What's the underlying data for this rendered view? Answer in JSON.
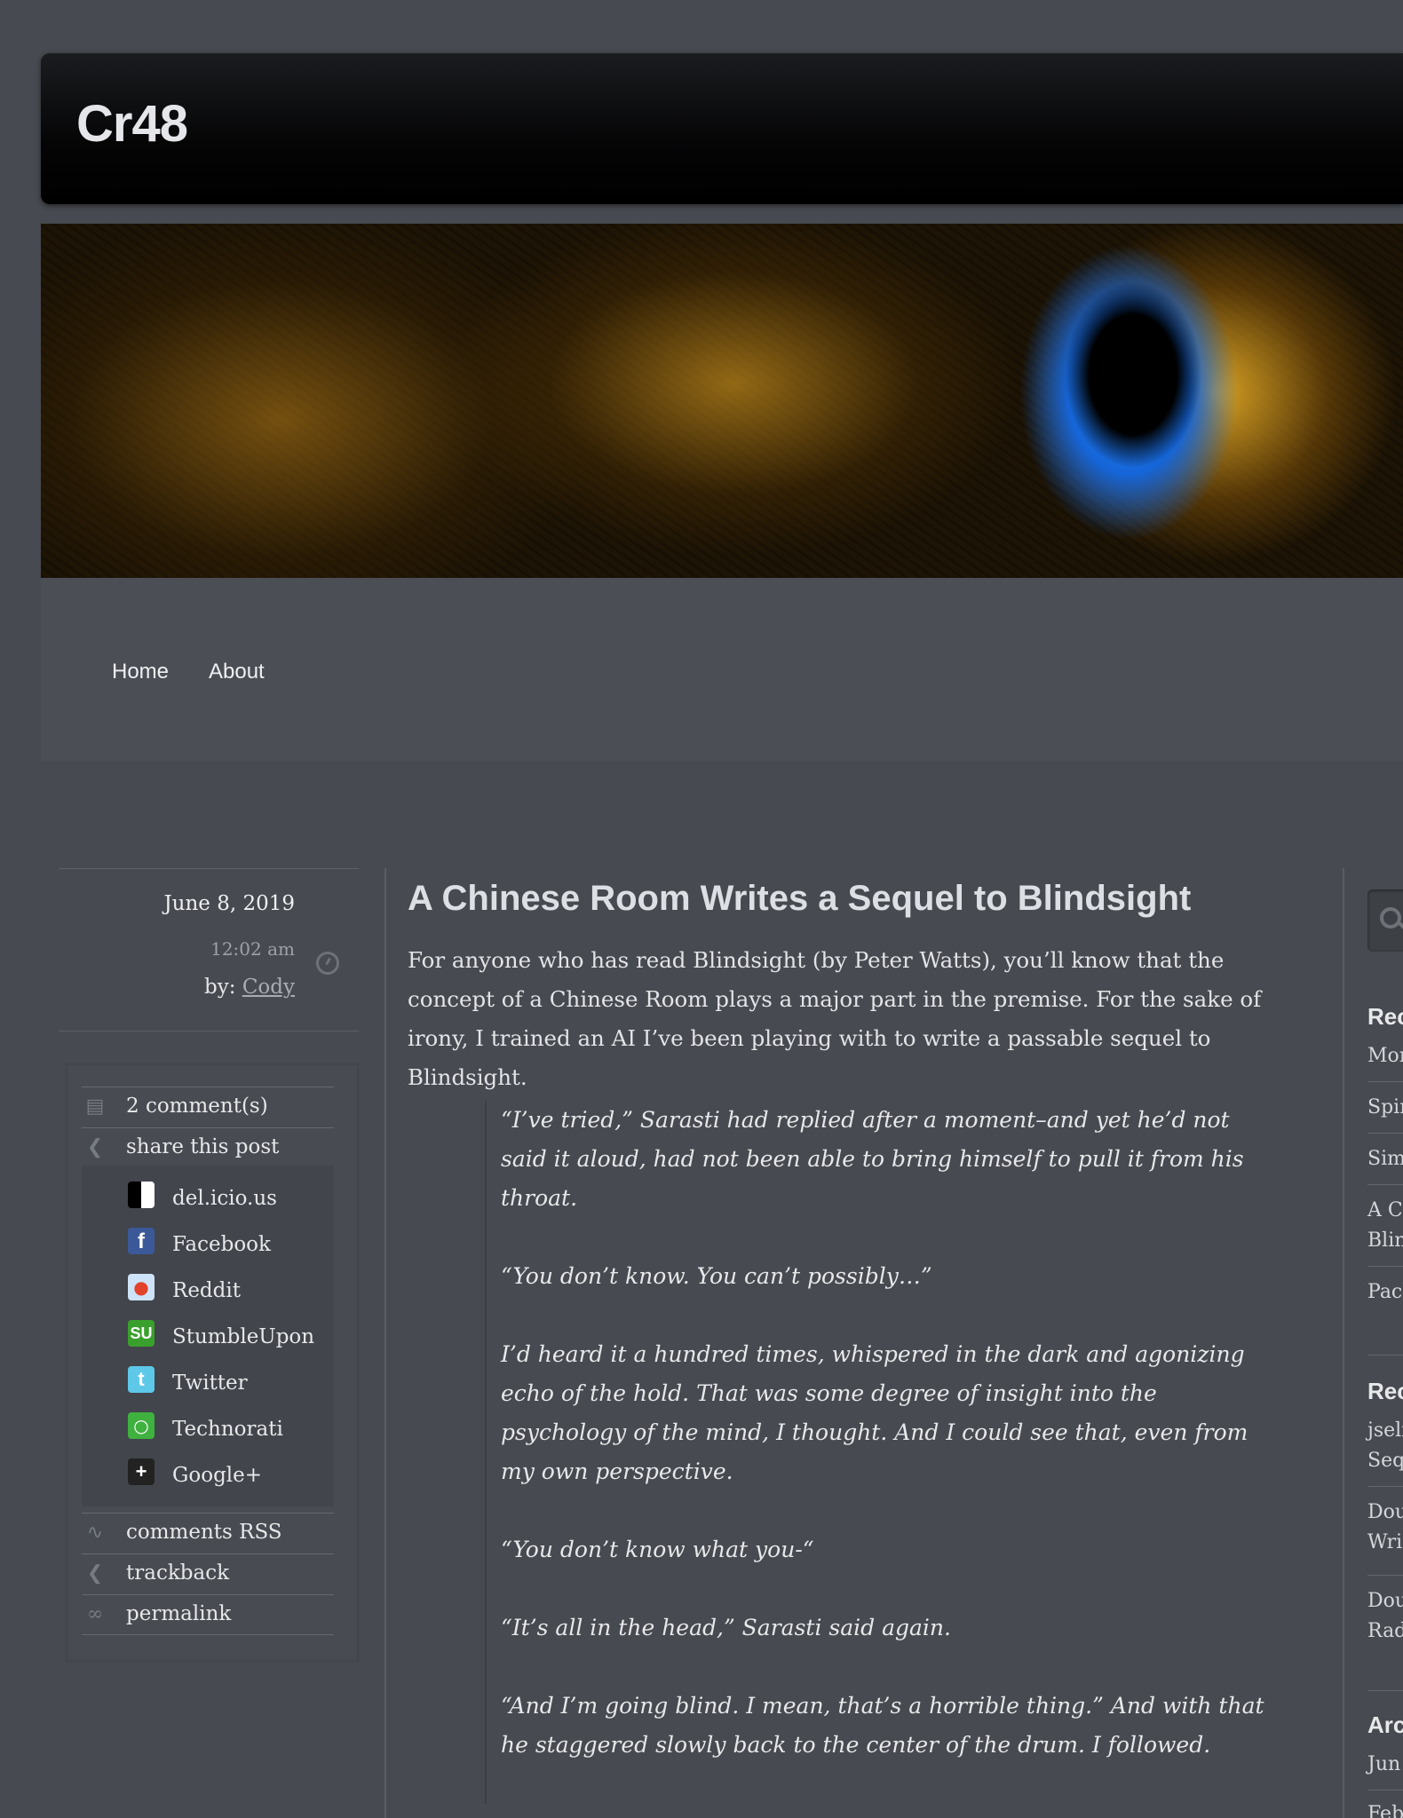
{
  "site": {
    "title": "Cr48"
  },
  "nav": {
    "items": [
      "Home",
      "About"
    ]
  },
  "post_meta": {
    "date": "June 8, 2019",
    "time": "12:02 am",
    "by_label": "by:",
    "author": "Cody"
  },
  "share_panel": {
    "comments": "2 comment(s)",
    "share": "share this post",
    "services": [
      {
        "label": "del.icio.us",
        "icon": "delicious-icon",
        "color": "#ffffff"
      },
      {
        "label": "Facebook",
        "icon": "facebook-icon",
        "color": "#3b5998"
      },
      {
        "label": "Reddit",
        "icon": "reddit-icon",
        "color": "#cee3f8"
      },
      {
        "label": "StumbleUpon",
        "icon": "stumbleupon-icon",
        "color": "#3aa02d"
      },
      {
        "label": "Twitter",
        "icon": "twitter-icon",
        "color": "#5ec8e8"
      },
      {
        "label": "Technorati",
        "icon": "technorati-icon",
        "color": "#3fb13f"
      },
      {
        "label": "Google+",
        "icon": "googleplus-icon",
        "color": "#222222"
      }
    ],
    "comments_rss": "comments RSS",
    "trackback": "trackback",
    "permalink": "permalink"
  },
  "post": {
    "title": "A Chinese Room Writes a Sequel to Blindsight",
    "intro": "For anyone who has read Blindsight (by Peter Watts), you’ll know that the concept of a Chinese Room plays a major part in the premise. For the sake of irony, I trained an AI I’ve been playing with to write a passable sequel to Blindsight.",
    "quote": [
      "“I’ve tried,” Sarasti had replied after a moment–and yet he’d not said it aloud, had not been able to bring himself to pull it from his throat.",
      "“You don’t know. You can’t possibly…”",
      "I’d heard it a hundred times, whispered in the dark and agonizing echo of the hold. That was some degree of insight into the psychology of the mind, I thought. And I could see that, even from my own perspective.",
      "“You don’t know what you-“",
      "“It’s all in the head,” Sarasti said again.",
      "“And I’m going blind. I mean, that’s a horrible thing.” And with that he staggered slowly back to the center of the drum. I followed."
    ]
  },
  "right_sidebar": {
    "heading1": "Rec",
    "items1": [
      "Mor",
      "Spir",
      "Sim",
      "A Cl",
      "Blin",
      "Pacl"
    ],
    "heading2": "Rec",
    "items2": [
      "jseli",
      "Seq",
      "Dou",
      "Wri",
      "Dou",
      "Rad"
    ],
    "heading3": "Arc",
    "items3": [
      "Jun",
      "Feb"
    ]
  }
}
